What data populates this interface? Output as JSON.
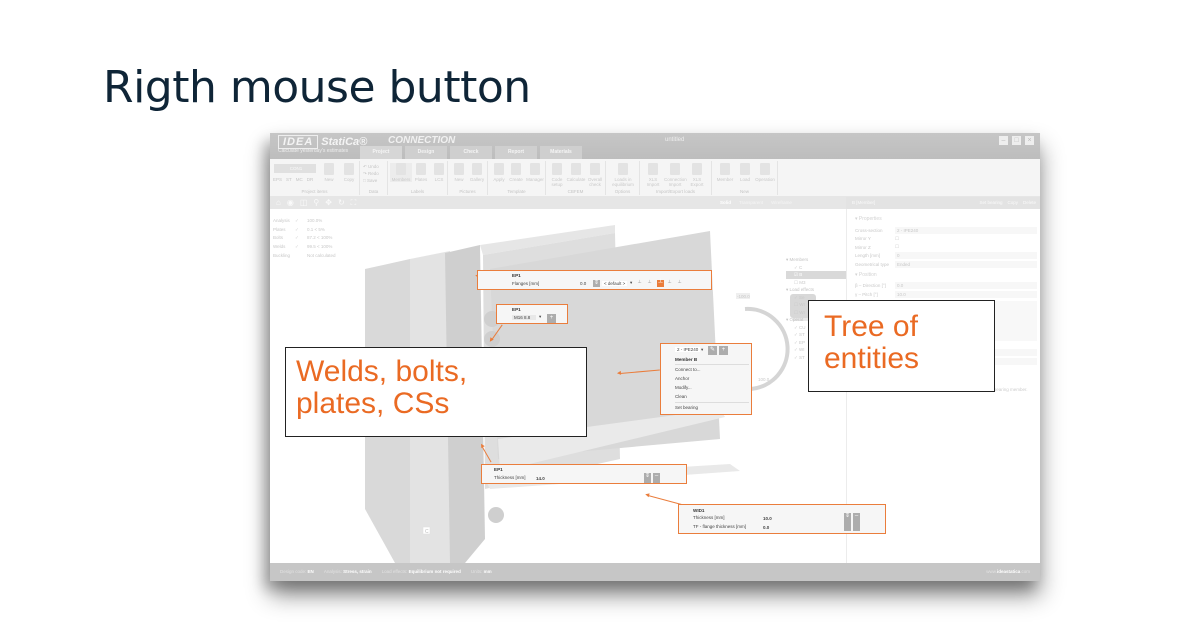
{
  "slide": {
    "title": "Rigth mouse button",
    "annotations": {
      "left": "Welds, bolts, plates, CSs",
      "right": "Tree of entities"
    },
    "accent_color": "#ea7d3c",
    "annotation_text_color": "#ea6a23"
  },
  "app": {
    "logo": "IDEA",
    "brand": "StatiCa®",
    "product": "CONNECTION",
    "tagline": "Calculate yesterday's estimates",
    "document_title": "untitled",
    "window_buttons": [
      "minimize",
      "maximize",
      "close"
    ],
    "tabs": [
      {
        "label": "Project",
        "active": true
      },
      {
        "label": "Design",
        "active": false
      },
      {
        "label": "Check",
        "active": false
      },
      {
        "label": "Report",
        "active": false
      },
      {
        "label": "Materials",
        "active": false
      }
    ],
    "ribbon": {
      "project_items": {
        "combo_value": "CON1",
        "labels": [
          "EPS",
          "ST",
          "MC",
          "DR"
        ],
        "new": "New",
        "copy": "Copy",
        "group": "Project items"
      },
      "data": {
        "undo": "Undo",
        "redo": "Redo",
        "save": "Save",
        "group": "Data"
      },
      "labels": {
        "members": "Members",
        "plates": "Plates",
        "lcs": "LCS",
        "group": "Labels"
      },
      "pictures": {
        "new": "New",
        "gallery": "Gallery",
        "group": "Pictures"
      },
      "template": {
        "apply": "Apply",
        "create": "Create",
        "manager": "Manager",
        "group": "Template"
      },
      "cbfem": {
        "code_setup": "Code setup",
        "calculate": "Calculate",
        "overall_check": "Overall check",
        "group": "CBFEM"
      },
      "options": {
        "loads_in_equilibrium": "Loads in equilibrium",
        "group": "Options"
      },
      "import_export": {
        "xls_import": "XLS Import",
        "connection_import": "Connection Import",
        "xls_export": "XLS Export",
        "group": "Import/Export loads"
      },
      "new": {
        "member": "Member",
        "load": "Load",
        "operation": "Operation",
        "group": "New"
      }
    },
    "view_toolbar": {
      "icons": [
        "home-icon",
        "eye-icon",
        "zoom-window-icon",
        "zoom-icon",
        "pan-icon",
        "rotate-icon",
        "fit-icon"
      ],
      "modes": [
        "Solid",
        "Transparent",
        "Wireframe"
      ]
    },
    "results": [
      {
        "label": "Analysis",
        "value": "100.0%"
      },
      {
        "label": "Plates",
        "value": "0.1 < 5%"
      },
      {
        "label": "Bolts",
        "value": "87.2 < 100%"
      },
      {
        "label": "Welds",
        "value": "99.5 < 100%"
      },
      {
        "label": "Buckling",
        "value": "Not calculated"
      }
    ],
    "tree": {
      "members_label": "Members",
      "members": [
        {
          "label": "C",
          "checked": true,
          "selected": false
        },
        {
          "label": "B",
          "checked": true,
          "selected": true
        },
        {
          "label": "M3",
          "checked": false,
          "selected": false
        }
      ],
      "load_effects_label": "Load effects",
      "load_effects": [
        "Se",
        "WI",
        "WI"
      ],
      "operations_label": "Operat",
      "operations": [
        "CU",
        "ST",
        "EP",
        "WI",
        "ST"
      ]
    },
    "viewport_labels": {
      "angle_top": "-100.0",
      "angle_bottom": "100.0",
      "member_tag": "C"
    },
    "properties_panel": {
      "header": "B [Member]",
      "actions": [
        "Set bearing",
        "Copy",
        "Delete"
      ],
      "properties_label": "Properties",
      "cross_section_label": "Cross-section",
      "cross_section_value": "2 - IPE240",
      "mirror_y_label": "Mirror Y",
      "mirror_z_label": "Mirror Z",
      "length_label": "Length [mm]",
      "length_value": "0",
      "geom_type_label": "Geometrical type",
      "geom_type_value": "Ended",
      "position_label": "Position",
      "direction_label": "β – Direction [°]",
      "direction_value": "0.0",
      "pitch_label": "γ – Pitch [°]",
      "pitch_value": "10.0",
      "description": "ones are 'connected'. The support in analysis model is applied on the bearing member."
    },
    "status_bar": {
      "design_code_label": "Design code:",
      "design_code": "EN",
      "analysis_label": "Analysis:",
      "analysis": "Stress, strain",
      "load_effects_label": "Load effects:",
      "load_effects": "Equilibrium not required",
      "units_label": "Units:",
      "units": "mm",
      "website_prefix": "www.",
      "website_bold": "ideastatica",
      "website_suffix": ".com"
    }
  },
  "callouts": {
    "flanges": {
      "title": "EP1",
      "label": "Flanges [mm]",
      "value": "0.0",
      "select": "< default >"
    },
    "bolts": {
      "title": "EP1",
      "value": "M16 8.8"
    },
    "member_menu": {
      "cross_section": "2 - IPE240",
      "title": "Member B",
      "items": [
        "Connect to...",
        "Anchor",
        "Modify...",
        "Clean"
      ],
      "footer_item": "Set bearing"
    },
    "plate": {
      "title": "EP1",
      "label": "Thickness [mm]",
      "value": "14.0"
    },
    "weld": {
      "title": "WID1",
      "rows": [
        {
          "label": "Thickness [mm]",
          "value": "10.0"
        },
        {
          "label": "TF - flange thickness [mm]",
          "value": "0.0"
        }
      ]
    }
  }
}
